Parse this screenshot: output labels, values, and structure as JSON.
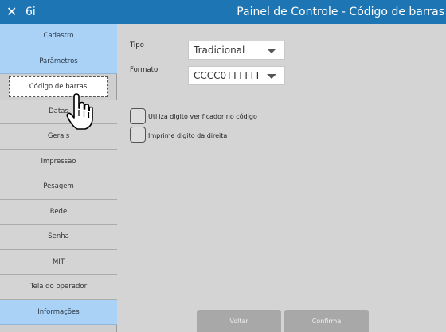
{
  "titlebar": {
    "close_icon": "close-icon",
    "app": "6i",
    "title": "Painel de Controle - Código de barras"
  },
  "sidebar": {
    "items": [
      {
        "label": "Cadastro",
        "kind": "category"
      },
      {
        "label": "Parâmetros",
        "kind": "category"
      },
      {
        "label": "Código de barras",
        "kind": "selected"
      },
      {
        "label": "Datas",
        "kind": "item"
      },
      {
        "label": "Gerais",
        "kind": "item"
      },
      {
        "label": "Impressão",
        "kind": "item"
      },
      {
        "label": "Pesagem",
        "kind": "item"
      },
      {
        "label": "Rede",
        "kind": "item"
      },
      {
        "label": "Senha",
        "kind": "item"
      },
      {
        "label": "MIT",
        "kind": "item"
      },
      {
        "label": "Tela do operador",
        "kind": "item"
      },
      {
        "label": "Informações",
        "kind": "category"
      }
    ]
  },
  "form": {
    "tipo_label": "Tipo",
    "tipo_value": "Tradicional",
    "formato_label": "Formato",
    "formato_value": "CCCC0TTTTTT",
    "check1_label": "Utiliza digito verificador no código",
    "check1_checked": false,
    "check2_label": "Imprime digito da direita",
    "check2_checked": false
  },
  "buttons": {
    "back": "Voltar",
    "confirm": "Confirma"
  },
  "colors": {
    "titlebar": "#1d75b4",
    "category": "#a9d2f6",
    "background": "#d4d4d4",
    "button": "#a8a8a8"
  },
  "cursor_icon": "hand-pointer-icon"
}
